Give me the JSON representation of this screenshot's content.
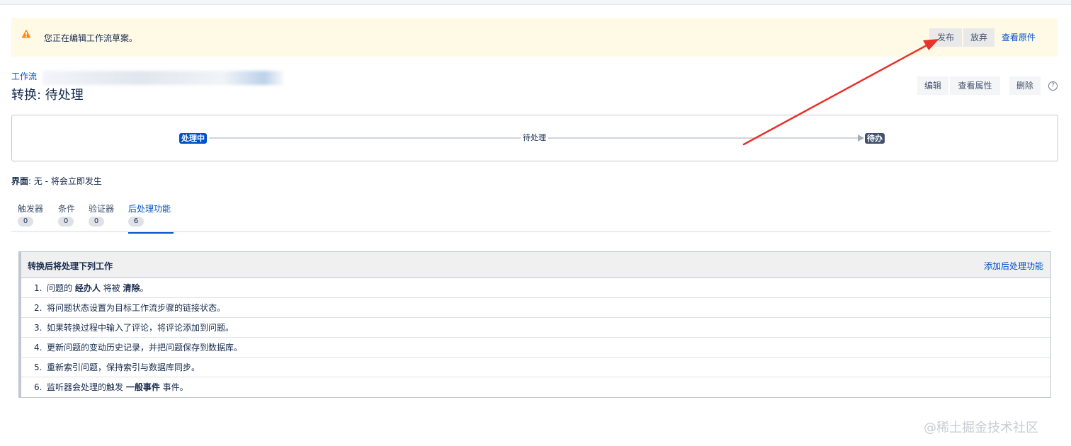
{
  "banner": {
    "message": "您正在编辑工作流草案。",
    "publish_label": "发布",
    "discard_label": "放弃",
    "view_original_label": "查看原件",
    "icon": "warning-icon",
    "background": "#fffae6",
    "icon_color": "#ff8b00"
  },
  "header": {
    "breadcrumb": "工作流",
    "title": "转换: 待处理",
    "edit_label": "编辑",
    "properties_label": "查看属性",
    "delete_label": "删除",
    "help_glyph": "?"
  },
  "diagram": {
    "from_status": "处理中",
    "transition": "待处理",
    "to_status": "待办",
    "from_color": "#0052cc",
    "to_color": "#42526e"
  },
  "screen": {
    "label": "界面",
    "value": ": 无 - 将会立即发生"
  },
  "tabs": [
    {
      "label": "触发器",
      "count": "0",
      "active": false
    },
    {
      "label": "条件",
      "count": "0",
      "active": false
    },
    {
      "label": "验证器",
      "count": "0",
      "active": false
    },
    {
      "label": "后处理功能",
      "count": "6",
      "active": true
    }
  ],
  "post_functions": {
    "title": "转换后将处理下列工作",
    "add_label": "添加后处理功能",
    "items": [
      {
        "num": "1.",
        "pre": "问题的 ",
        "bold1": "经办人",
        "mid": " 将被 ",
        "bold2": "清除",
        "post": "。"
      },
      {
        "num": "2.",
        "text": "将问题状态设置为目标工作流步骤的链接状态。"
      },
      {
        "num": "3.",
        "text": "如果转换过程中输入了评论，将评论添加到问题。"
      },
      {
        "num": "4.",
        "text": "更新问题的变动历史记录，并把问题保存到数据库。"
      },
      {
        "num": "5.",
        "text": "重新索引问题，保持索引与数据库同步。"
      },
      {
        "num": "6.",
        "pre": "监听器会处理的触发 ",
        "bold1": "一般事件",
        "post": " 事件。"
      }
    ]
  },
  "watermark": "@稀土掘金技术社区",
  "annotation_color": "#e8322a"
}
